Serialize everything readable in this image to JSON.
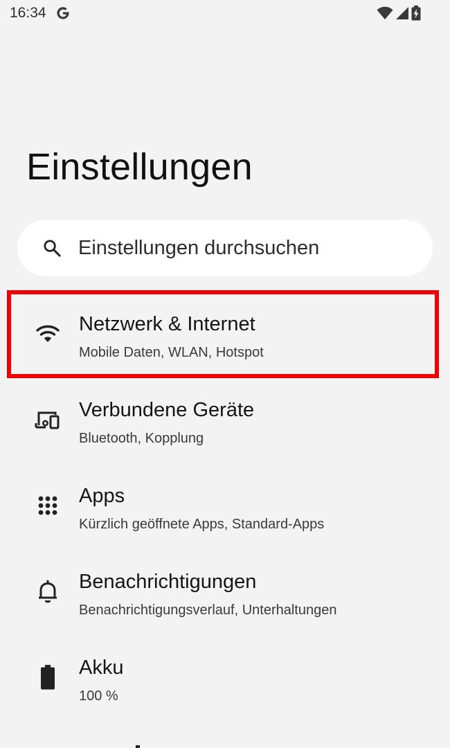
{
  "status_bar": {
    "time": "16:34",
    "google_icon": "google-g-icon",
    "icons": [
      "wifi-signal-icon",
      "cellular-signal-icon",
      "battery-charging-icon"
    ]
  },
  "page": {
    "title": "Einstellungen"
  },
  "search": {
    "placeholder": "Einstellungen durchsuchen",
    "value": "",
    "icon": "search-icon"
  },
  "items": [
    {
      "title": "Netzwerk & Internet",
      "subtitle": "Mobile Daten, WLAN, Hotspot",
      "icon": "wifi-icon"
    },
    {
      "title": "Verbundene Geräte",
      "subtitle": "Bluetooth, Kopplung",
      "icon": "connected-devices-icon"
    },
    {
      "title": "Apps",
      "subtitle": "Kürzlich geöffnete Apps, Standard-Apps",
      "icon": "apps-grid-icon"
    },
    {
      "title": "Benachrichtigungen",
      "subtitle": "Benachrichtigungsverlauf, Unterhaltungen",
      "icon": "bell-icon"
    },
    {
      "title": "Akku",
      "subtitle": "100 %",
      "icon": "battery-icon"
    }
  ],
  "colors": {
    "background": "#f3f3f3",
    "search_background": "#ffffff",
    "highlight": "#f00000",
    "text_primary": "#151515",
    "text_secondary": "#3a3a3a"
  }
}
